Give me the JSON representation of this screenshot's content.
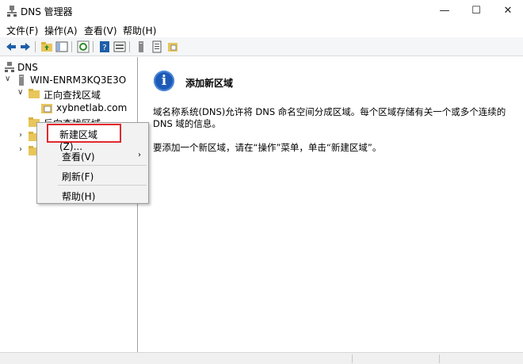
{
  "window": {
    "title": "DNS 管理器",
    "minimize_glyph": "—",
    "maximize_glyph": "☐",
    "close_glyph": "✕"
  },
  "menu": [
    {
      "label": "文件(F)"
    },
    {
      "label": "操作(A)"
    },
    {
      "label": "查看(V)"
    },
    {
      "label": "帮助(H)"
    }
  ],
  "toolbar": {
    "icons": [
      "back-arrow-icon",
      "forward-arrow-icon",
      "folder-up-icon",
      "show-tree-icon",
      "refresh-icon",
      "help-icon",
      "properties-icon",
      "server-icon",
      "list-icon",
      "zone-icon"
    ]
  },
  "tree": {
    "root": {
      "label": "DNS",
      "expander": ""
    },
    "server": {
      "label": "WIN-ENRM3KQ3E3O",
      "expander": "∨"
    },
    "forward_zone": {
      "label": "正向查找区域",
      "expander": "∨"
    },
    "zone": {
      "label": "xybnetlab.com"
    },
    "reverse_zone": {
      "label": "反向查找区域"
    },
    "collapsed1": {
      "expander": "›"
    },
    "collapsed2": {
      "expander": "›"
    }
  },
  "content": {
    "info_glyph": "i",
    "title": "添加新区域",
    "para1": "域名称系统(DNS)允许将 DNS 命名空间分成区域。每个区域存储有关一个或多个连续的 DNS 域的信息。",
    "para2": "要添加一个新区域，请在“操作”菜单，单击“新建区域”。"
  },
  "context_menu": {
    "items": [
      {
        "label": "新建区域(Z)..."
      },
      {
        "label": "查看(V)",
        "arrow": "›"
      },
      {
        "label": "刷新(F)"
      },
      {
        "label": "帮助(H)"
      }
    ]
  },
  "colors": {
    "accent": "#1d5ab8",
    "highlight_border": "#e3282e",
    "folder": "#e8c65a"
  }
}
